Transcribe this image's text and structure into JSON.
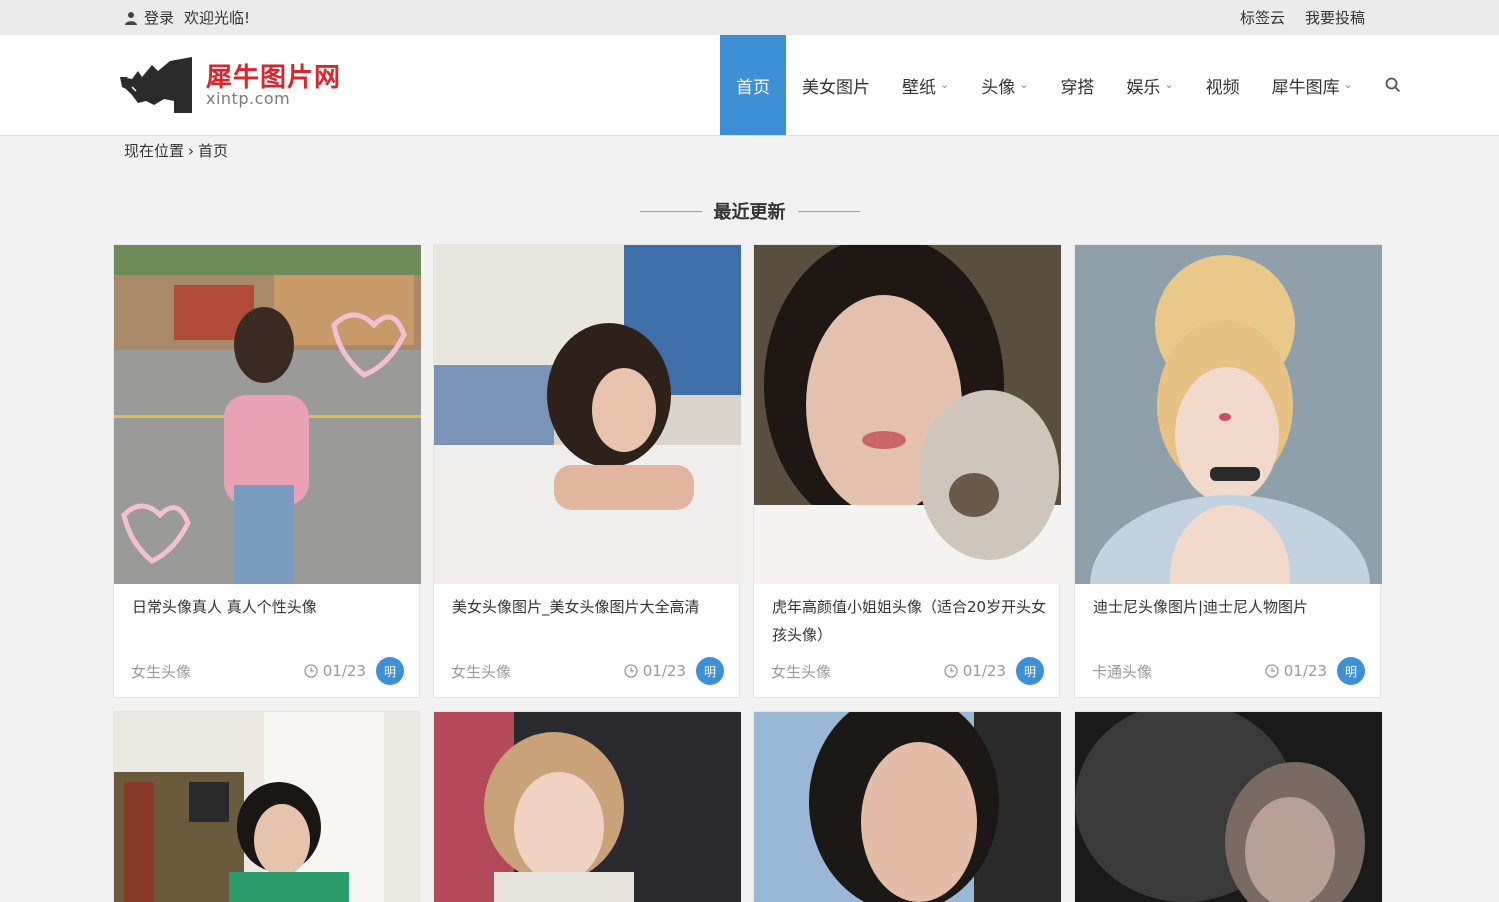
{
  "topbar": {
    "login": "登录",
    "welcome": "欢迎光临!",
    "links": [
      "标签云",
      "我要投稿"
    ]
  },
  "logo": {
    "name": "犀牛图片网",
    "domain": "xintp.com"
  },
  "nav": [
    {
      "label": "首页",
      "active": true,
      "dropdown": false
    },
    {
      "label": "美女图片",
      "active": false,
      "dropdown": false
    },
    {
      "label": "壁纸",
      "active": false,
      "dropdown": true
    },
    {
      "label": "头像",
      "active": false,
      "dropdown": true
    },
    {
      "label": "穿搭",
      "active": false,
      "dropdown": false
    },
    {
      "label": "娱乐",
      "active": false,
      "dropdown": true
    },
    {
      "label": "视频",
      "active": false,
      "dropdown": false
    },
    {
      "label": "犀牛图库",
      "active": false,
      "dropdown": true
    }
  ],
  "breadcrumb": {
    "prefix": "现在位置",
    "separator": "›",
    "current": "首页"
  },
  "section": {
    "title": "最近更新"
  },
  "cards": [
    {
      "title": "日常头像真人 真人个性头像",
      "category": "女生头像",
      "date": "01/23",
      "author": "明"
    },
    {
      "title": "美女头像图片_美女头像图片大全高清",
      "category": "女生头像",
      "date": "01/23",
      "author": "明"
    },
    {
      "title": "虎年高颜值小姐姐头像（适合20岁开头女孩头像）",
      "category": "女生头像",
      "date": "01/23",
      "author": "明"
    },
    {
      "title": "迪士尼头像图片|迪士尼人物图片",
      "category": "卡通头像",
      "date": "01/23",
      "author": "明"
    },
    {
      "title": "",
      "category": "",
      "date": "",
      "author": ""
    },
    {
      "title": "",
      "category": "",
      "date": "",
      "author": ""
    },
    {
      "title": "",
      "category": "",
      "date": "",
      "author": ""
    },
    {
      "title": "",
      "category": "",
      "date": "",
      "author": ""
    }
  ],
  "colors": {
    "accent": "#3d8fd6",
    "brand_red": "#d9262c"
  },
  "icons": [
    "user-icon",
    "search-icon",
    "clock-icon",
    "chevron-down-icon",
    "rhino-logo"
  ]
}
